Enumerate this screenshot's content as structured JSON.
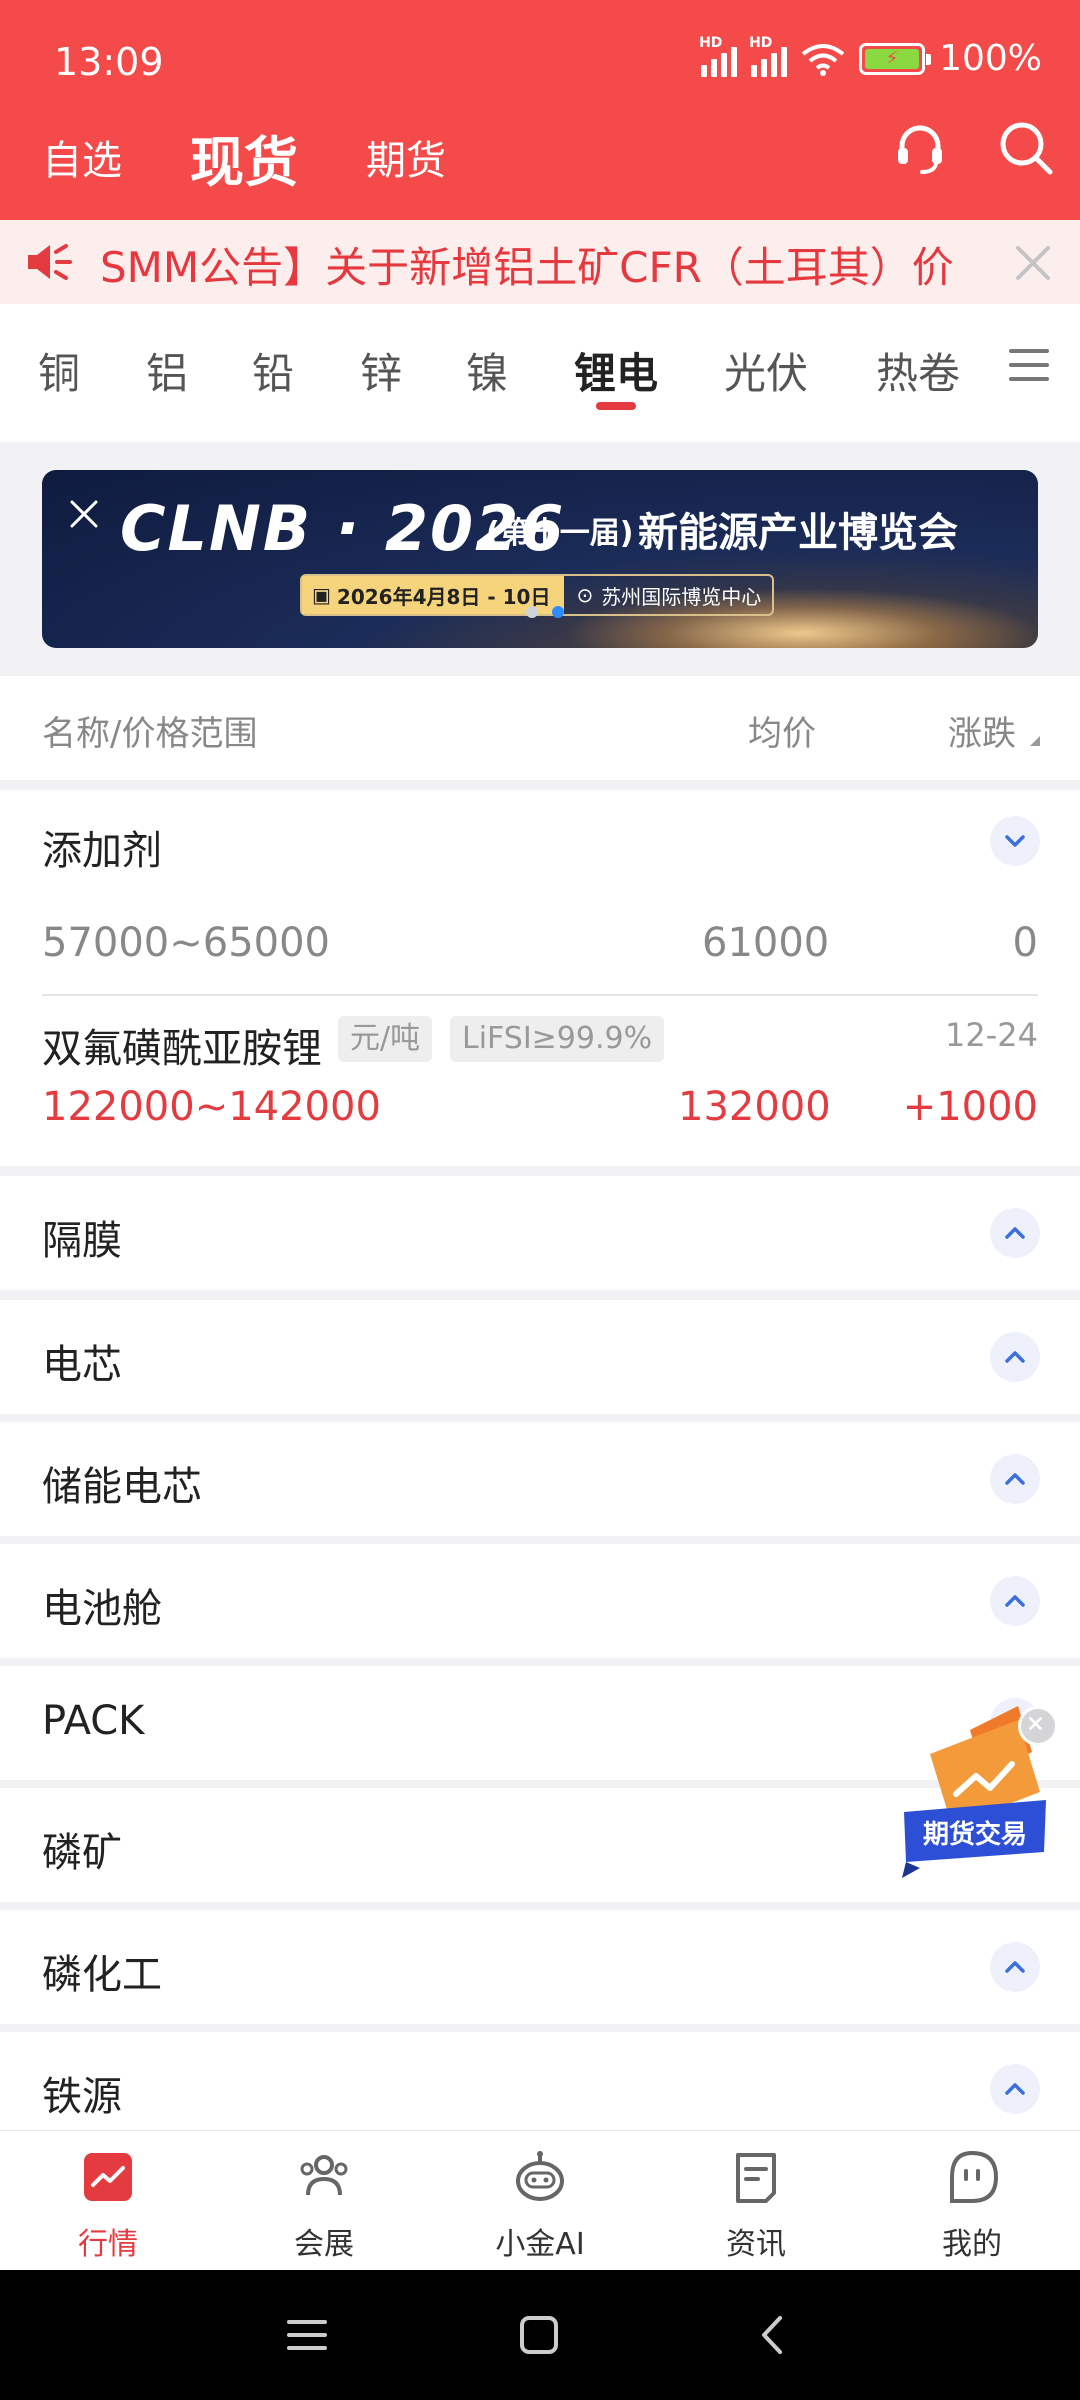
{
  "status_bar": {
    "time": "13:09",
    "battery": "100%"
  },
  "header": {
    "tabs": [
      {
        "label": "自选"
      },
      {
        "label": "现货"
      },
      {
        "label": "期货"
      }
    ],
    "active_tab": "现货"
  },
  "notice": {
    "text": "SMM公告】关于新增铝土矿CFR（土耳其）价"
  },
  "categories": {
    "items": [
      "铜",
      "铝",
      "铅",
      "锌",
      "镍",
      "锂电",
      "光伏",
      "热卷"
    ],
    "active": "锂电"
  },
  "banner": {
    "brand": "CLNB · 2026",
    "edition": "(第十一届)",
    "title": "新能源产业博览会",
    "date": "2026年4月8日 - 10日",
    "venue": "苏州国际博览中心"
  },
  "table_header": {
    "name": "名称/价格范围",
    "avg": "均价",
    "change": "涨跌"
  },
  "additive_section": {
    "title": "添加剂",
    "rows": [
      {
        "range": "57000~65000",
        "avg": "61000",
        "change": "0"
      }
    ],
    "product": {
      "name": "双氟磺酰亚胺锂",
      "unit": "元/吨",
      "spec": "LiFSI≥99.9%",
      "date": "12-24",
      "range": "122000~142000",
      "avg": "132000",
      "change": "+1000"
    }
  },
  "collapsed_sections": [
    "隔膜",
    "电芯",
    "储能电芯",
    "电池舱",
    "PACK",
    "磷矿",
    "磷化工",
    "铁源"
  ],
  "float_badge": {
    "label": "期货交易"
  },
  "bottom_nav": [
    {
      "label": "行情",
      "icon": "market-icon"
    },
    {
      "label": "会展",
      "icon": "people-icon"
    },
    {
      "label": "小金AI",
      "icon": "robot-icon"
    },
    {
      "label": "资讯",
      "icon": "news-icon"
    },
    {
      "label": "我的",
      "icon": "profile-icon"
    }
  ],
  "colors": {
    "brand_red": "#f44a4a",
    "price_red": "#e33b3f",
    "accent_blue": "#3b6fe0"
  }
}
